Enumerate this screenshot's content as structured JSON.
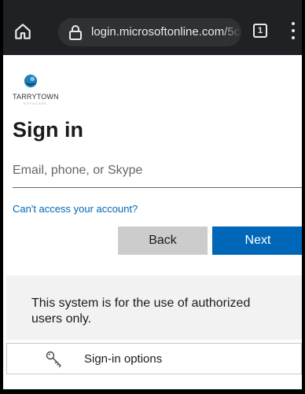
{
  "browser": {
    "url": "login.microsoftonline.com/5c",
    "tab_count": "1",
    "icons": {
      "home": "home-icon",
      "lock": "lock-icon",
      "tabs": "tab-switcher-icon",
      "menu": "more-vert-icon"
    }
  },
  "logo": {
    "wordmark": "TARRYTOWN",
    "tagline": "EXPOCARE"
  },
  "signin": {
    "title": "Sign in",
    "email_placeholder": "Email, phone, or Skype",
    "email_value": "",
    "help_link": "Can't access your account?",
    "back_label": "Back",
    "next_label": "Next"
  },
  "notice": {
    "text": "This system is for the use of authorized users only."
  },
  "options": {
    "label": "Sign-in options",
    "icon": "key-icon"
  },
  "colors": {
    "chrome_bg": "#202124",
    "accent": "#0067b8",
    "secondary_button": "#cccccc",
    "notice_bg": "#f2f2f2"
  }
}
